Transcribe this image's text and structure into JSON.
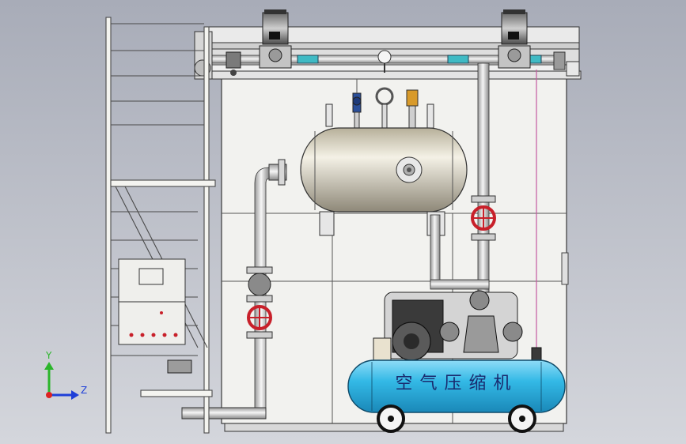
{
  "viewport": {
    "background_top": "#a8acb8",
    "background_bottom": "#d4d6dc"
  },
  "compressor": {
    "tank_label": "空气压缩机",
    "tank_color": "#33b9e6",
    "tank_label_color": "#1a2a6e"
  },
  "valves": {
    "handwheel_color": "#c8202a"
  },
  "triad": {
    "y_label": "Y",
    "z_label": "Z",
    "y_color": "#2bb52b",
    "z_color": "#1e3fd8"
  }
}
